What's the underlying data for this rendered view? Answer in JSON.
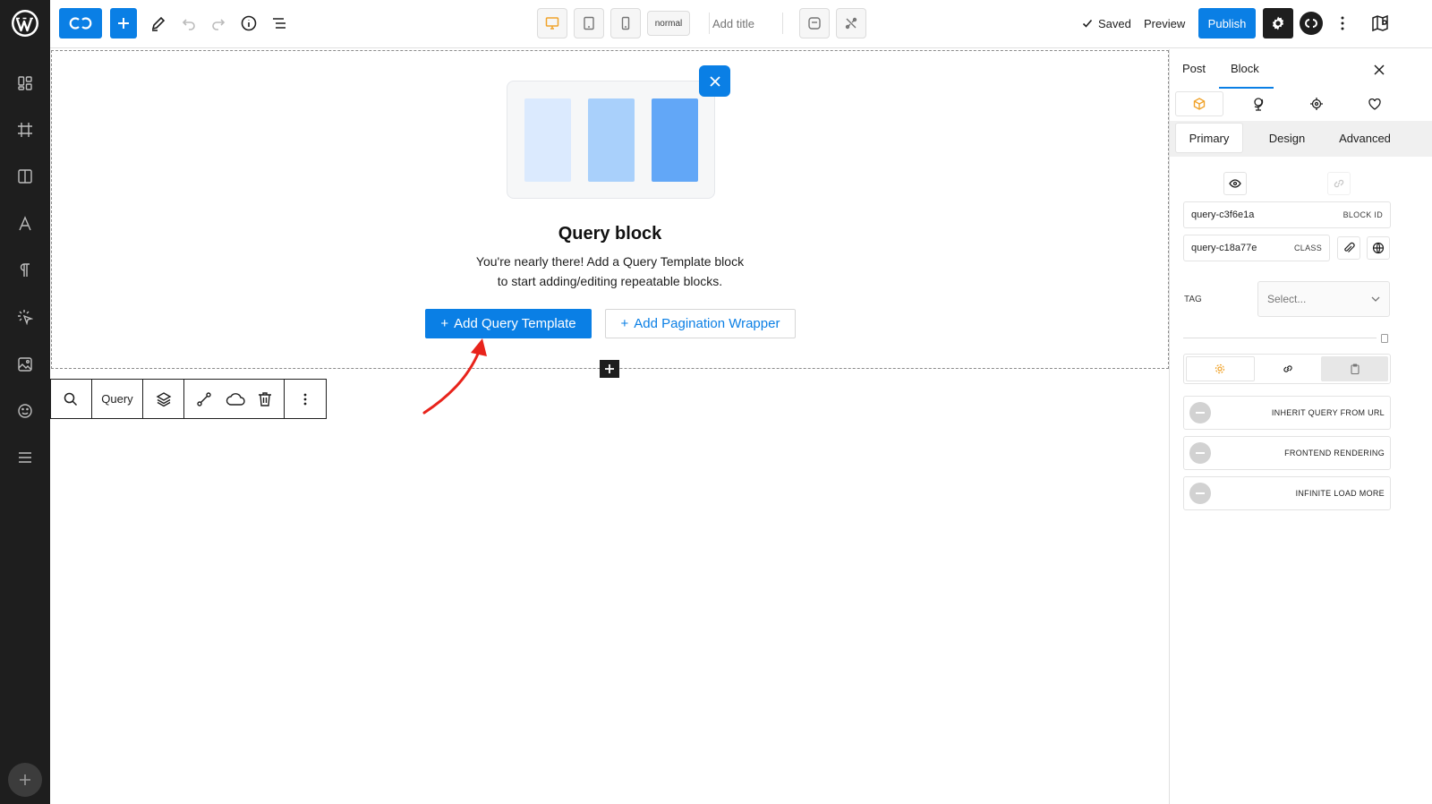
{
  "topbar": {
    "device_mode": "normal",
    "add_title": "Add title",
    "saved": "Saved",
    "preview": "Preview",
    "publish": "Publish"
  },
  "query_block": {
    "title": "Query block",
    "desc_line1": "You're nearly there! Add a Query Template block",
    "desc_line2": "to start adding/editing repeatable blocks.",
    "add_template": "Add Query Template",
    "add_pagination": "Add Pagination Wrapper",
    "plus": "+"
  },
  "block_toolbar": {
    "label": "Query"
  },
  "sidebar": {
    "tab_post": "Post",
    "tab_block": "Block",
    "sub_primary": "Primary",
    "sub_design": "Design",
    "sub_advanced": "Advanced",
    "block_id_value": "query-c3f6e1a",
    "block_id_label": "BLOCK ID",
    "class_value": "query-c18a77e",
    "class_label": "CLASS",
    "tag_label": "TAG",
    "tag_placeholder": "Select...",
    "toggles": [
      "INHERIT QUERY FROM URL",
      "FRONTEND RENDERING",
      "INFINITE LOAD MORE"
    ]
  },
  "colors": {
    "accent": "#0a7fe5",
    "rail": "#1e1e1e",
    "arrow": "#e8231b",
    "orange_icon": "#f0a32b"
  }
}
